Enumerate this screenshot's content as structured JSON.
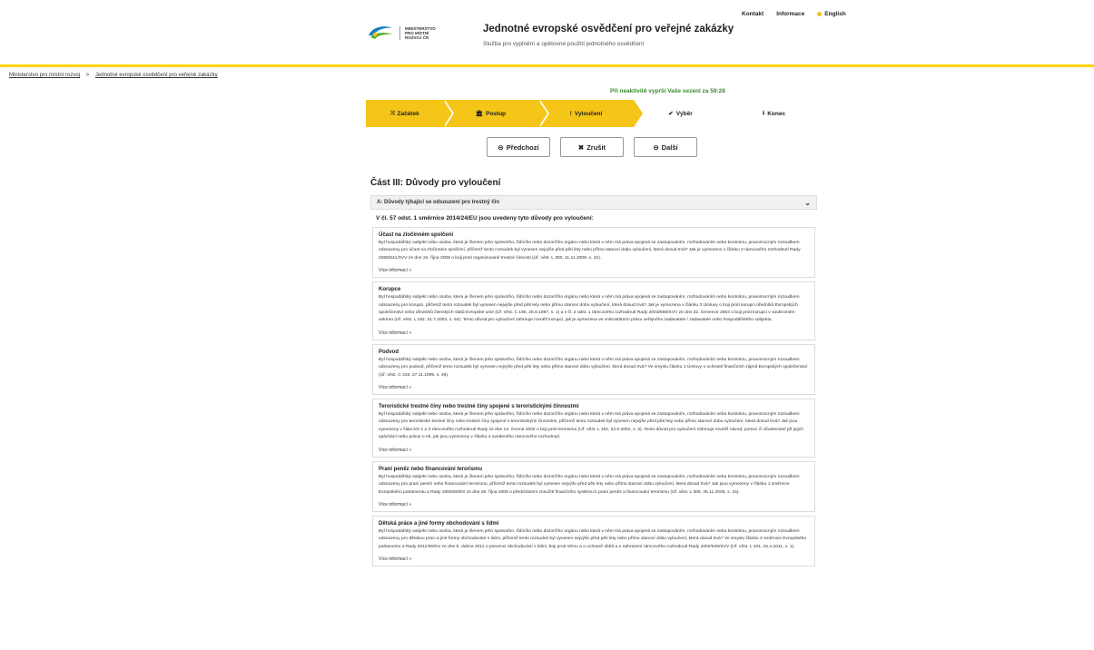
{
  "topnav": {
    "kontakt": "Kontakt",
    "informace": "Informace",
    "lang": "English"
  },
  "logo": {
    "line1": "MINISTERSTVO",
    "line2": "PRO MÍSTNÍ",
    "line3": "ROZVOJ ČR"
  },
  "site": {
    "title": "Jednotné evropské osvědčení pro veřejné zakázky",
    "subtitle": "Služba pro vyplnění a opětovné použití jednotného osvědčení"
  },
  "breadcrumb": {
    "item1": "Ministerstvo pro místní rozvoj",
    "sep": ">",
    "item2": "Jednotné evropské osvědčení pro veřejné zakázky"
  },
  "timer": "Při neaktivitě vyprší Vaše sezení za 59:28",
  "steps": [
    {
      "icon": "⤨",
      "label": "Začátek"
    },
    {
      "icon": "🏛",
      "label": "Postup"
    },
    {
      "icon": "!",
      "label": "Vyloučení"
    },
    {
      "icon": "✔",
      "label": "Výběr"
    },
    {
      "icon": "⭳",
      "label": "Konec"
    }
  ],
  "buttons": {
    "prev": "Předchozí",
    "cancel": "Zrušit",
    "next": "Další"
  },
  "part_title": "Část III: Důvody pro vyloučení",
  "accordion": "A: Důvody týkající se odsouzení pro trestný čin",
  "intro": "V čl. 57 odst. 1 směrnice 2014/24/EU jsou uvedeny tyto důvody pro vyloučení:",
  "more_label": "Více informací »",
  "grounds": [
    {
      "title": "Účast na zločinném spolčení",
      "text": "Byl hospodářský subjekt nebo osoba, která je členem jeho správního, řídícího nebo dozorčího orgánu nebo která v něm má práva spojená se zastupováním, rozhodováním nebo kontrolou, pravomocným rozsudkem odsouzeny pro účast na zločinném spolčení, přičemž tento rozsudek byl vynesen nejvýše před pěti lety nebo přímo stanoví dobu vyloučení, která dosud trvá? Jak je vymezeno v článku 2 rámcového rozhodnutí Rady 2008/841/SVV ze dne 24. října 2008 o boji proti organizované trestné činnosti (Úř. věst. L 300, 11.11.2008, s. 42)."
    },
    {
      "title": "Korupce",
      "text": "Byl hospodářský subjekt nebo osoba, která je členem jeho správního, řídícího nebo dozorčího orgánu nebo která v něm má práva spojená se zastupováním, rozhodováním nebo kontrolou, pravomocným rozsudkem odsouzeny pro korupci, přičemž tento rozsudek byl vynesen nejvýše před pěti lety nebo přímo stanoví dobu vyloučení, která dosud trvá? Jak je vymezena v článku 3 Úmluvy o boji proti korupci úředníků Evropských společenství nebo úředníků členských států Evropské unie (Úř. věst. C 195, 25.6.1997, s. 1) a v čl. 2 odst. 1 rámcového rozhodnutí Rady 2003/568/SVV ze dne 22. července 2003 o boji proti korupci v soukromém sektoru (Úř. věst. L 192, 31.7.2003, s. 54). Tento důvod pro vyloučení zahrnuje rovněž korupci, jak je vymezena ve vnitrostátním právu veřejného zadavatele / zadavatele nebo hospodářského subjektu."
    },
    {
      "title": "Podvod",
      "text": "Byl hospodářský subjekt nebo osoba, která je členem jeho správního, řídícího nebo dozorčího orgánu nebo která v něm má práva spojená se zastupováním, rozhodováním nebo kontrolou, pravomocným rozsudkem odsouzeny pro podvod, přičemž tento rozsudek byl vynesen nejvýše před pěti lety nebo přímo stanoví dobu vyloučení, která dosud trvá? Ve smyslu článku 1 Úmluvy o ochraně finančních zájmů Evropských společenství (Úř. věst. C 316, 27.11.1995, s. 48)."
    },
    {
      "title": "Teroristické trestné činy nebo trestné činy spojené s teroristickými činnostmi",
      "text": "Byl hospodářský subjekt nebo osoba, která je členem jeho správního, řídícího nebo dozorčího orgánu nebo která v něm má práva spojená se zastupováním, rozhodováním nebo kontrolou, pravomocným rozsudkem odsouzeny pro teroristické trestné činy nebo trestné činy spojené s teroristickými činnostmi, přičemž tento rozsudek byl vynesen nejvýše před pěti lety nebo přímo stanoví dobu vyloučení, která dosud trvá? Jak jsou vymezeny v článcích 1 a 3 rámcového rozhodnutí Rady ze dne 13. června 2002 o boji proti terorismu (Úř. věst. L 164, 22.6.2002, s. 3). Tento důvod pro vyloučení zahrnuje rovněž návod, pomoc či účastenství při jejich spáchání nebo pokus o ně, jak jsou vymezeny v článku 4 uvedeného rámcového rozhodnutí."
    },
    {
      "title": "Praní peněz nebo financování terorismu",
      "text": "Byl hospodářský subjekt nebo osoba, která je členem jeho správního, řídícího nebo dozorčího orgánu nebo která v něm má práva spojená se zastupováním, rozhodováním nebo kontrolou, pravomocným rozsudkem odsouzeny pro praní peněz nebo financování terorismu, přičemž tento rozsudek byl vynesen nejvýše před pěti lety nebo přímo stanoví dobu vyloučení, která dosud trvá? Jak jsou vymezeny v článku 1 směrnice Evropského parlamentu a Rady 2005/60/ES ze dne 26. října 2005 o předcházení zneužití finančního systému k praní peněz a financování terorismu (Úř. věst. L 309, 25.11.2005, s. 15)."
    },
    {
      "title": "Dětská práce a jiné formy obchodování s lidmi",
      "text": "Byl hospodářský subjekt nebo osoba, která je členem jeho správního, řídícího nebo dozorčího orgánu nebo která v něm má práva spojená se zastupováním, rozhodováním nebo kontrolou, pravomocným rozsudkem odsouzeny pro dětskou práci a jiné formy obchodování s lidmi, přičemž tento rozsudek byl vynesen nejvýše před pěti lety nebo přímo stanoví dobu vyloučení, která dosud trvá? Ve smyslu článku 2 směrnice Evropského parlamentu a Rady 2011/36/EU ze dne 5. dubna 2011 o prevenci obchodování s lidmi, boji proti němu a o ochraně obětí a o nahrazení rámcového rozhodnutí Rady 2002/629/SVV (Úř. věst. L 101, 15.4.2011, s. 1)."
    }
  ]
}
